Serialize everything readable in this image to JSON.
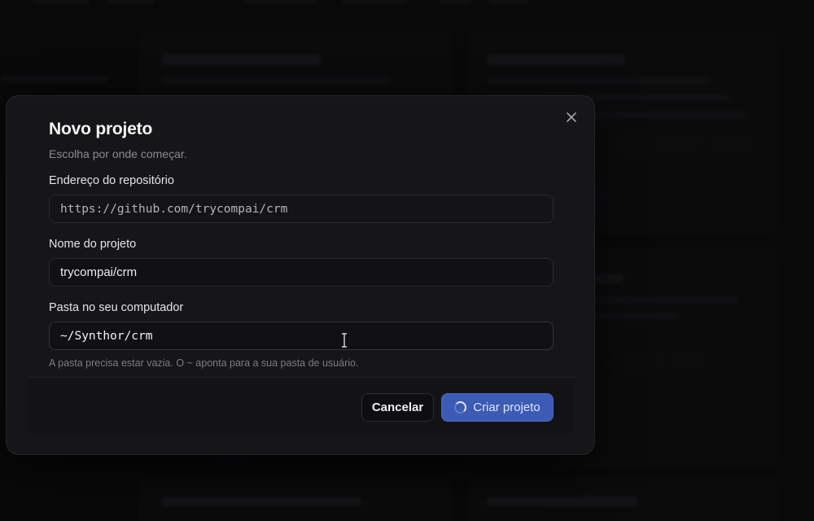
{
  "dialog": {
    "title": "Novo projeto",
    "subtitle": "Escolha por onde começar.",
    "repo": {
      "label": "Endereço do repositório",
      "value": "https://github.com/trycompai/crm"
    },
    "name": {
      "label": "Nome do projeto",
      "value": "trycompai/crm"
    },
    "folder": {
      "label": "Pasta no seu computador",
      "value": "~/Synthor/crm",
      "hint": "A pasta precisa estar vazia. O ~ aponta para a sua pasta de usuário."
    },
    "buttons": {
      "cancel": "Cancelar",
      "create": "Criar projeto"
    }
  },
  "icons": {
    "close": "close-icon",
    "spinner": "loading-spinner-icon",
    "cursor": "text-cursor-icon"
  },
  "colors": {
    "background": "#0b0b0c",
    "dialog": "#161618",
    "primary": "#3b5bb5"
  }
}
